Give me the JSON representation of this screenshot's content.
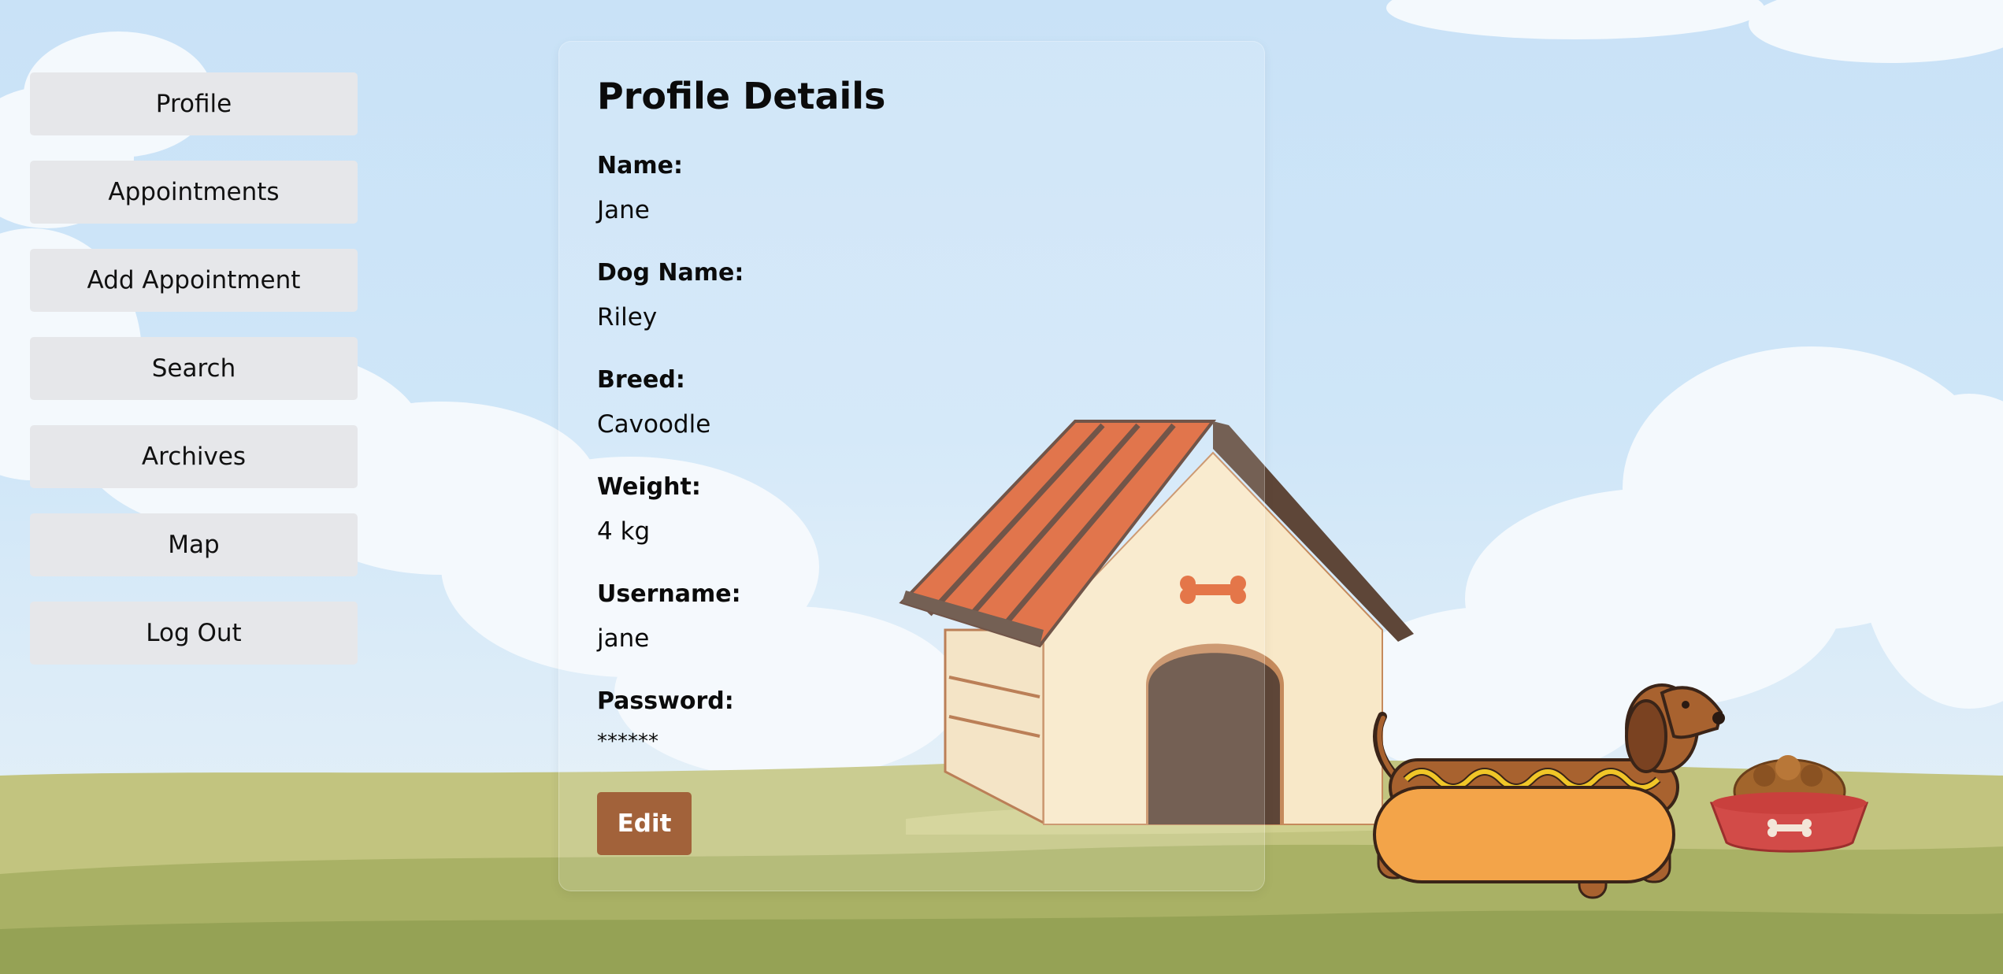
{
  "sidebar": {
    "items": [
      {
        "label": "Profile"
      },
      {
        "label": "Appointments"
      },
      {
        "label": "Add Appointment"
      },
      {
        "label": "Search"
      },
      {
        "label": "Archives"
      },
      {
        "label": "Map"
      },
      {
        "label": "Log Out"
      }
    ]
  },
  "profile": {
    "title": "Profile Details",
    "fields": [
      {
        "label": "Name:",
        "value": "Jane"
      },
      {
        "label": "Dog Name:",
        "value": "Riley"
      },
      {
        "label": "Breed:",
        "value": "Cavoodle"
      },
      {
        "label": "Weight:",
        "value": "4 kg"
      },
      {
        "label": "Username:",
        "value": "jane"
      },
      {
        "label": "Password:",
        "value": "******"
      }
    ],
    "edit_label": "Edit"
  },
  "colors": {
    "sky": "#cfe6f8",
    "grass": "#b8bf72",
    "nav_button_bg": "#e6e7ea",
    "edit_button_bg": "#a2623a",
    "roof": "#d85a2e",
    "house_wall": "#f7e6c4",
    "door": "#5e4638"
  },
  "background": {
    "illustration": [
      "cloud-icon",
      "doghouse-icon",
      "bone-icon",
      "hotdog-dachshund-icon",
      "dog-food-bowl-icon"
    ]
  }
}
